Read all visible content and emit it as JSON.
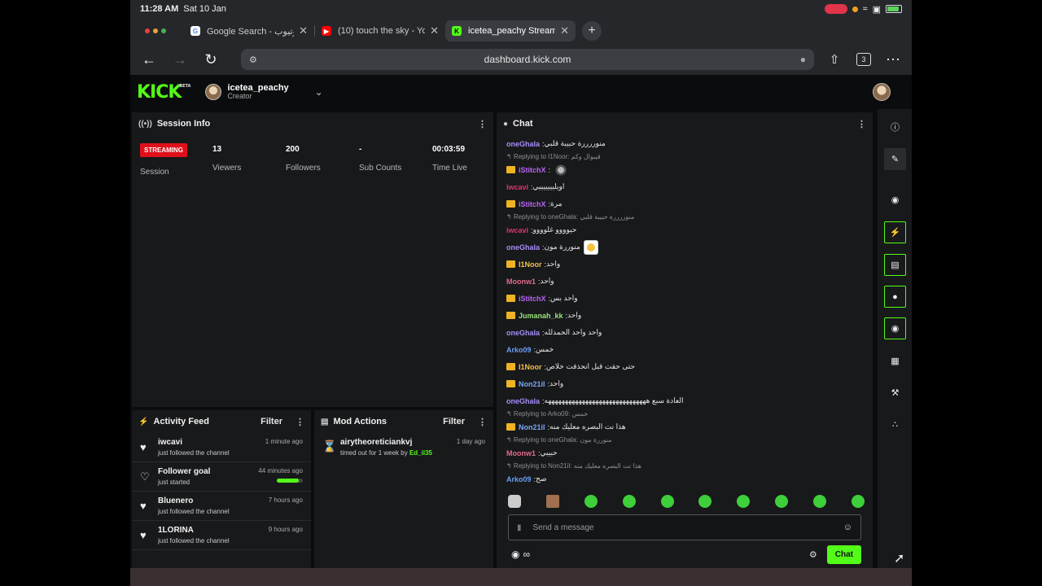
{
  "status": {
    "time": "11:28 AM",
    "date": "Sat 10 Jan"
  },
  "tabs": [
    {
      "label": "Google Search - يوتيوب",
      "fav": "G",
      "favColor": "#ffffff",
      "favText": "#4285f4"
    },
    {
      "label": "(10) touch the sky - YouTube",
      "fav": "▶",
      "favColor": "#ff0000",
      "favText": "#ffffff"
    },
    {
      "label": "icetea_peachy Stream - Kick",
      "fav": "K",
      "favColor": "#53fc18",
      "favText": "#000000"
    }
  ],
  "browser": {
    "url": "dashboard.kick.com",
    "tab_count": "3"
  },
  "kick": {
    "logo": "KICK",
    "beta": "BETA",
    "channel_name": "icetea_peachy",
    "channel_role": "Creator"
  },
  "session": {
    "title": "Session Info",
    "badge": "STREAMING",
    "session_label": "Session",
    "stats": [
      {
        "value": "13",
        "label": "Viewers"
      },
      {
        "value": "200",
        "label": "Followers"
      },
      {
        "value": "-",
        "label": "Sub Counts"
      },
      {
        "value": "00:03:59",
        "label": "Time Live"
      }
    ]
  },
  "activity": {
    "title": "Activity Feed",
    "filter": "Filter",
    "items": [
      {
        "who": "iwcavi",
        "when": "1 minute ago",
        "desc": "just followed the channel"
      },
      {
        "who": "Follower goal",
        "when": "44 minutes ago",
        "desc": "just started",
        "progress": 0.85
      },
      {
        "who": "Bluenero",
        "when": "7 hours ago",
        "desc": "just followed the channel"
      },
      {
        "who": "1LORINA",
        "when": "9 hours ago",
        "desc": "just followed the channel"
      }
    ]
  },
  "mod": {
    "title": "Mod Actions",
    "filter": "Filter",
    "items": [
      {
        "who": "airytheoreticiankvj",
        "when": "1 day ago",
        "desc": "timed out for 1 week by",
        "by": "Ed_il35"
      }
    ]
  },
  "chat": {
    "title": "Chat",
    "placeholder": "Send a message",
    "send_label": "Chat",
    "points": "∞",
    "colors": {
      "oneGhala": "#a58df7",
      "iStitchX": "#b565f0",
      "iwcavi": "#e0356f",
      "I1Noor": "#f0c14b",
      "Moonw1": "#e06a8c",
      "Jumanah_kk": "#9be27a",
      "Arko09": "#6a9df0",
      "Non21il": "#7aa6f5"
    },
    "messages": [
      {
        "user": "oneGhala",
        "text": "منوررررة حبيبة قلبي"
      },
      {
        "reply": "Replying to I1Noor: قيبوال وكم"
      },
      {
        "user": "iStitchX",
        "crown": true,
        "text": "",
        "emote": "star"
      },
      {
        "user": "iwcavi",
        "text": "اويليييييييي"
      },
      {
        "user": "iStitchX",
        "crown": true,
        "text": "مرة"
      },
      {
        "reply": "Replying to oneGhala: منوررررة حبيبة قلبي"
      },
      {
        "user": "iwcavi",
        "text": "حيوووو غلوووو"
      },
      {
        "user": "oneGhala",
        "text": "منوررة مون",
        "emote": "smile"
      },
      {
        "user": "I1Noor",
        "crown": true,
        "text": "واحد"
      },
      {
        "user": "Moonw1",
        "text": "واحد"
      },
      {
        "user": "iStitchX",
        "crown": true,
        "text": "واحد بس"
      },
      {
        "user": "Jumanah_kk",
        "crown": true,
        "text": "واحد"
      },
      {
        "user": "oneGhala",
        "text": "واحد واحد الحمدلله"
      },
      {
        "user": "Arko09",
        "text": "خمس"
      },
      {
        "user": "I1Noor",
        "crown": true,
        "text": "حتى حقت قبل انحذفت خلاص"
      },
      {
        "user": "Non21il",
        "crown": true,
        "text": "واحد"
      },
      {
        "user": "oneGhala",
        "text": "العادة سبع ههههههههههههههههههههههههههههههه"
      },
      {
        "reply": "Replying to Arko09: خمس"
      },
      {
        "user": "Non21il",
        "crown": true,
        "text": "هذا نت البصره معليك منه"
      },
      {
        "reply": "Replying to oneGhala: منوررة مون"
      },
      {
        "user": "Moonw1",
        "text": "حبيبي"
      },
      {
        "reply": "Replying to Non21il: هذا نت البصره معليك منه"
      },
      {
        "user": "Arko09",
        "text": "صح"
      }
    ]
  },
  "tools": [
    "info-icon",
    "pencil-icon",
    "camera-icon",
    "lightning-icon",
    "document-icon",
    "chat-icon",
    "broadcast-icon",
    "layout-icon",
    "wrench-icon",
    "apps-icon"
  ]
}
